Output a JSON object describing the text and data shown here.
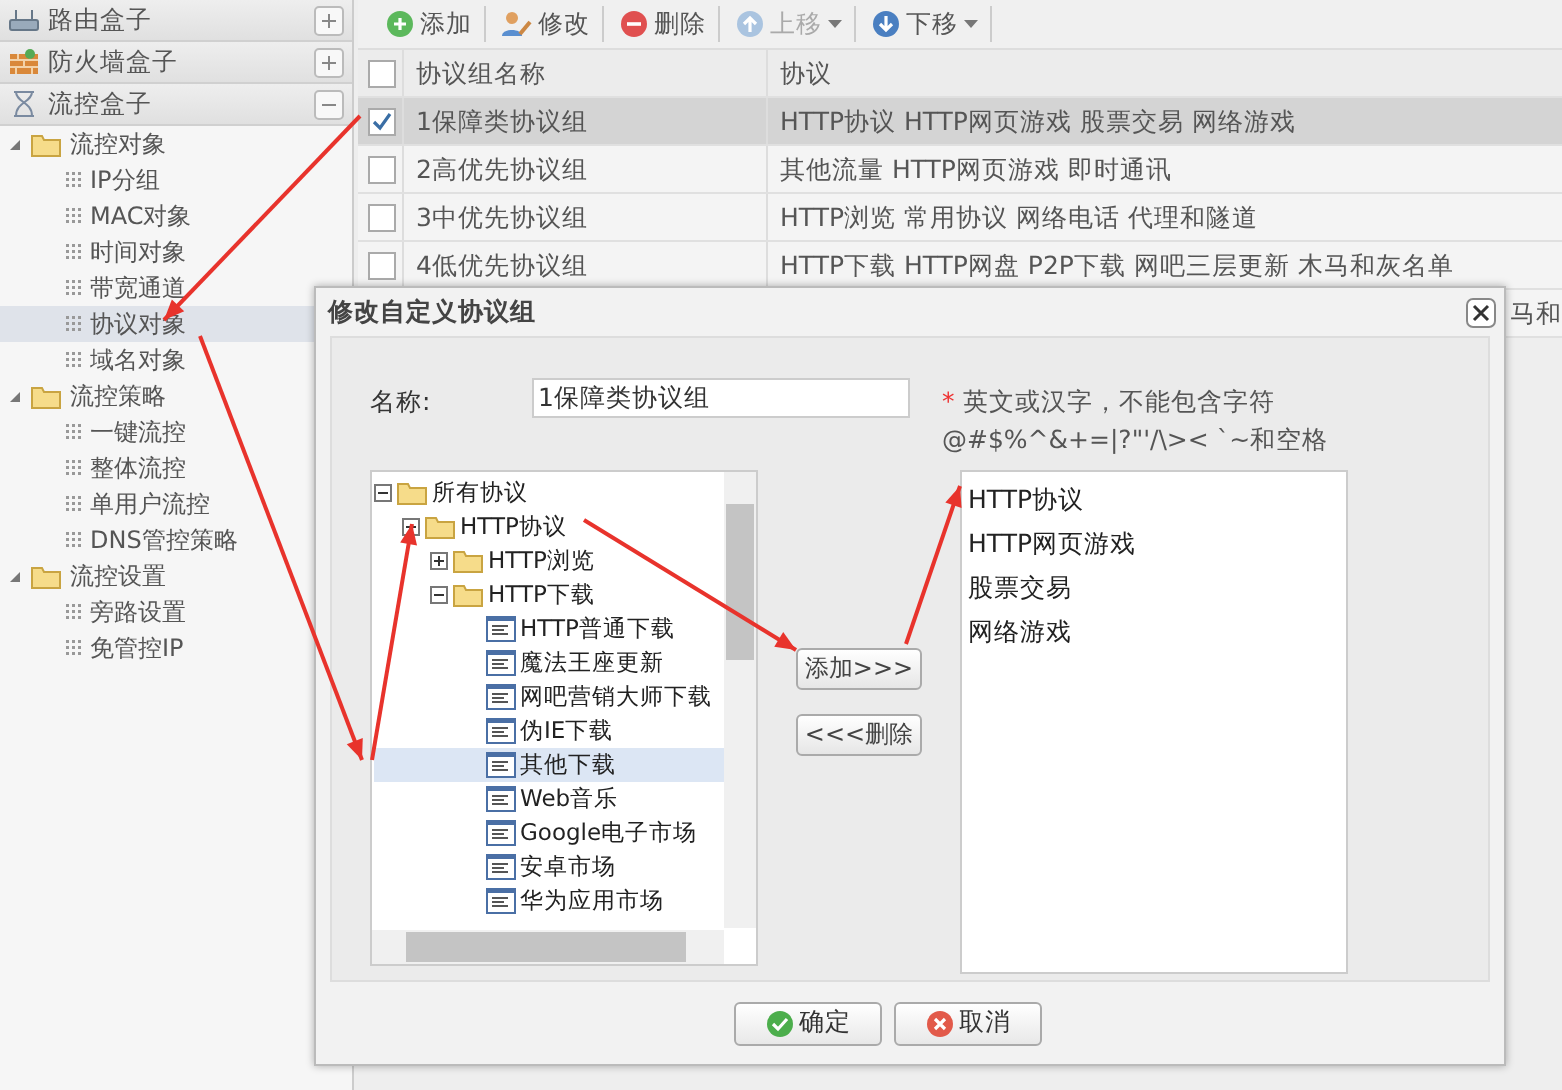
{
  "sidebar": {
    "panels": [
      {
        "title": "路由盒子",
        "kind": "router",
        "expanded": false
      },
      {
        "title": "防火墙盒子",
        "kind": "firewall",
        "expanded": false
      },
      {
        "title": "流控盒子",
        "kind": "flow",
        "expanded": true
      }
    ],
    "tree": [
      {
        "label": "流控对象",
        "expanded": true,
        "children": [
          {
            "label": "IP分组",
            "selected": false
          },
          {
            "label": "MAC对象",
            "selected": false
          },
          {
            "label": "时间对象",
            "selected": false
          },
          {
            "label": "带宽通道",
            "selected": false
          },
          {
            "label": "协议对象",
            "selected": true
          },
          {
            "label": "域名对象",
            "selected": false
          }
        ]
      },
      {
        "label": "流控策略",
        "expanded": true,
        "children": [
          {
            "label": "一键流控",
            "selected": false
          },
          {
            "label": "整体流控",
            "selected": false
          },
          {
            "label": "单用户流控",
            "selected": false
          },
          {
            "label": "DNS管控策略",
            "selected": false
          }
        ]
      },
      {
        "label": "流控设置",
        "expanded": true,
        "children": [
          {
            "label": "旁路设置",
            "selected": false
          },
          {
            "label": "免管控IP",
            "selected": false
          }
        ]
      }
    ]
  },
  "toolbar": [
    {
      "label": "添加",
      "kind": "add",
      "disabled": false,
      "dropdown": false
    },
    {
      "label": "修改",
      "kind": "edit",
      "disabled": false,
      "dropdown": false
    },
    {
      "label": "删除",
      "kind": "delete",
      "disabled": false,
      "dropdown": false
    },
    {
      "label": "上移",
      "kind": "up",
      "disabled": true,
      "dropdown": true
    },
    {
      "label": "下移",
      "kind": "down",
      "disabled": false,
      "dropdown": true
    }
  ],
  "table": {
    "all_checked": false,
    "columns": [
      "协议组名称",
      "协议"
    ],
    "rows": [
      {
        "name": "1保障类协议组",
        "protocols": "HTTP协议 HTTP网页游戏 股票交易 网络游戏",
        "checked": true,
        "selected": true
      },
      {
        "name": "2高优先协议组",
        "protocols": "其他流量 HTTP网页游戏 即时通讯",
        "checked": false,
        "selected": false
      },
      {
        "name": "3中优先协议组",
        "protocols": "HTTP浏览 常用协议 网络电话 代理和隧道",
        "checked": false,
        "selected": false
      },
      {
        "name": "4低优先协议组",
        "protocols": "HTTP下载 HTTP网盘 P2P下载 网吧三层更新 木马和灰名单",
        "checked": false,
        "selected": false
      }
    ],
    "covered_row_text": "马和"
  },
  "dialog": {
    "title": "修改自定义协议组",
    "name_label": "名称:",
    "name_value": "1保障类协议组",
    "required_mark": "*",
    "hint_lines": [
      "英文或汉字，不能包含字符",
      "@#$%^&+=|?\"'/\\>< `~和空格"
    ],
    "tree": [
      {
        "label": "所有协议",
        "kind": "folder",
        "expanded": true,
        "selected": false,
        "children": [
          {
            "label": "HTTP协议",
            "kind": "folder",
            "expanded": true,
            "selected": false,
            "children": [
              {
                "label": "HTTP浏览",
                "kind": "folder",
                "expanded": false,
                "selected": false
              },
              {
                "label": "HTTP下载",
                "kind": "folder",
                "expanded": true,
                "selected": false,
                "children": [
                  {
                    "label": "HTTP普通下载",
                    "kind": "file",
                    "selected": false
                  },
                  {
                    "label": "魔法王座更新",
                    "kind": "file",
                    "selected": false
                  },
                  {
                    "label": "网吧营销大师下载",
                    "kind": "file",
                    "selected": false
                  },
                  {
                    "label": "伪IE下载",
                    "kind": "file",
                    "selected": false
                  },
                  {
                    "label": "其他下载",
                    "kind": "file",
                    "selected": true
                  },
                  {
                    "label": "Web音乐",
                    "kind": "file",
                    "selected": false
                  },
                  {
                    "label": "Google电子市场",
                    "kind": "file",
                    "selected": false
                  },
                  {
                    "label": "安卓市场",
                    "kind": "file",
                    "selected": false
                  },
                  {
                    "label": "华为应用市场",
                    "kind": "file",
                    "selected": false
                  }
                ]
              }
            ]
          }
        ]
      }
    ],
    "add_button": "添加>>>",
    "remove_button": "<<<删除",
    "chosen": [
      "HTTP协议",
      "HTTP网页游戏",
      "股票交易",
      "网络游戏"
    ],
    "ok_button": "确定",
    "cancel_button": "取消"
  }
}
